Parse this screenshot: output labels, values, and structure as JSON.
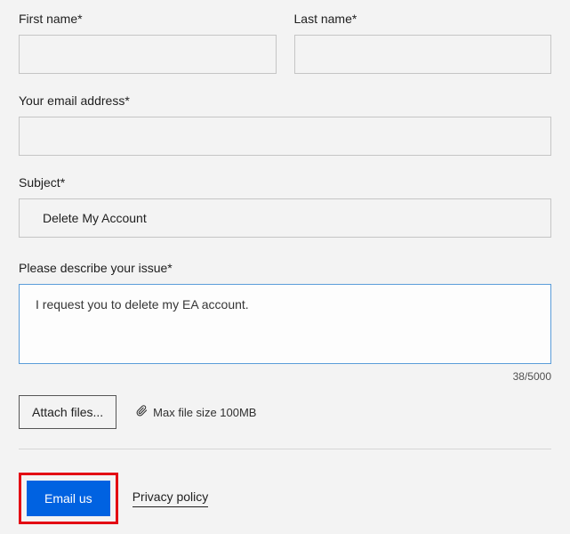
{
  "form": {
    "first_name": {
      "label": "First name*",
      "value": ""
    },
    "last_name": {
      "label": "Last name*",
      "value": ""
    },
    "email": {
      "label": "Your email address*",
      "value": ""
    },
    "subject": {
      "label": "Subject*",
      "value": "Delete My Account"
    },
    "description": {
      "label": "Please describe your issue*",
      "value": "I request you to delete my EA account."
    },
    "char_counter": "38/5000",
    "attach_label": "Attach files...",
    "max_file_note": "Max file size 100MB",
    "submit_label": "Email us",
    "privacy_label": "Privacy policy"
  }
}
